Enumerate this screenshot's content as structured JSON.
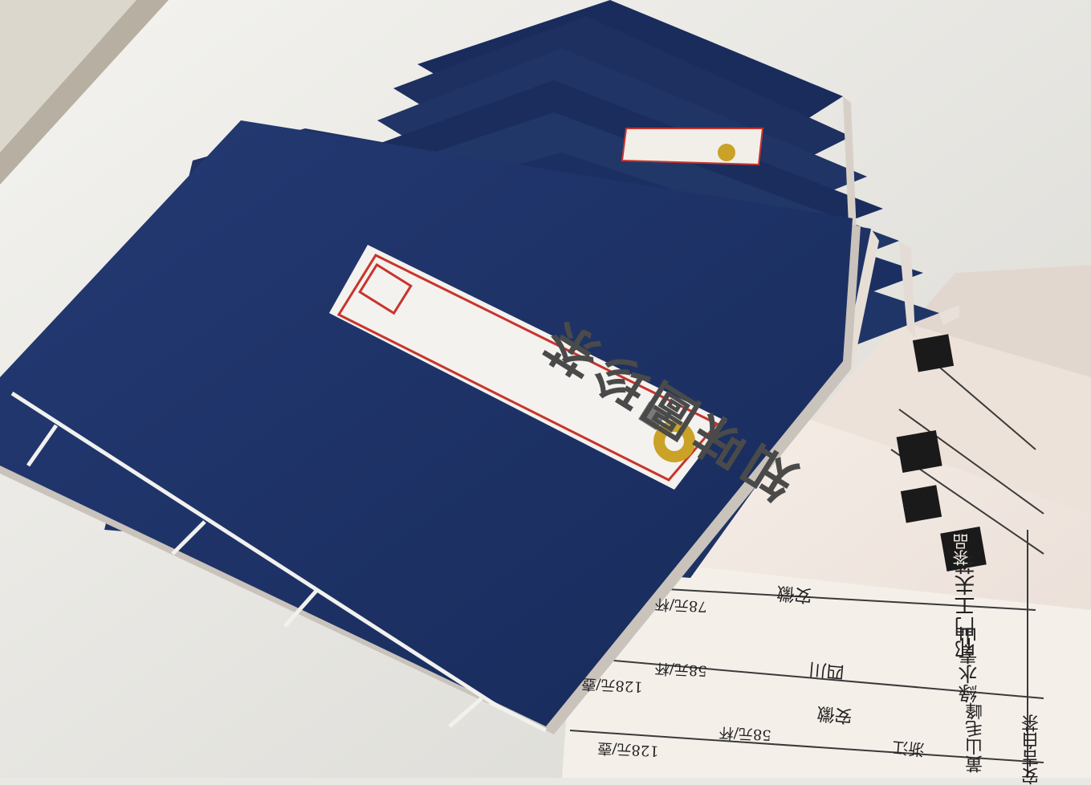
{
  "cover": {
    "title": "知味圖珍茶",
    "seal": "印"
  },
  "menu": {
    "category_label": "茶品",
    "tea_names": [
      "祁門工夫茶",
      "綠水青山",
      "黃山毛峰",
      "安吉白茶"
    ],
    "origins": [
      "安徽",
      "四川",
      "安徽",
      "浙江"
    ],
    "prices": [
      "78元/杯",
      "58元/杯",
      "128元/壺",
      "58元/杯",
      "128元/壺"
    ]
  },
  "colors": {
    "cover_blue": "#1c2f63",
    "label_paper": "#f4f2ee",
    "label_border": "#c8342e",
    "thread": "#f1f1ee",
    "menu_paper": "#f3ebe4",
    "background": "#e9e8e4"
  }
}
